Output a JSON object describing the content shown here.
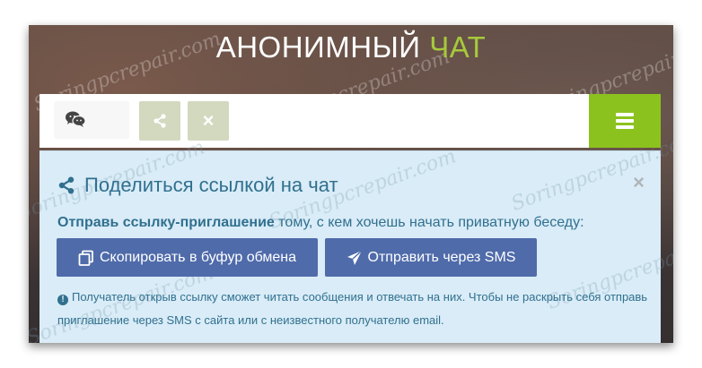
{
  "header": {
    "title_main": "АНОНИМНЫЙ",
    "title_accent": "ЧАТ"
  },
  "toolbar": {
    "chat_icon": "wechat-bubbles-icon",
    "share_icon": "share-icon",
    "close_label": "×",
    "menu_icon": "hamburger-icon"
  },
  "panel": {
    "title": "Поделиться ссылкой на чат",
    "close_label": "×",
    "invite_bold": "Отправь ссылку-приглашение",
    "invite_rest": " тому, с кем хочешь начать приватную беседу:",
    "copy_button": "Скопировать в буфур обмена",
    "sms_button": "Отправить через SMS",
    "note": "Получатель открыв ссылку сможет читать сообщения и отвечать на них. Чтобы не раскрыть себя отправь приглашение через SMS с сайта или с неизвестного получателю email."
  },
  "watermark": "Soringpcrepair.com",
  "colors": {
    "accent_green": "#8cc21e",
    "title_accent": "#a7c93b",
    "button_blue": "#4f6baa",
    "panel_bg": "#d9ecf7",
    "panel_text": "#31708f",
    "disabled_btn": "#d2d9bf"
  }
}
